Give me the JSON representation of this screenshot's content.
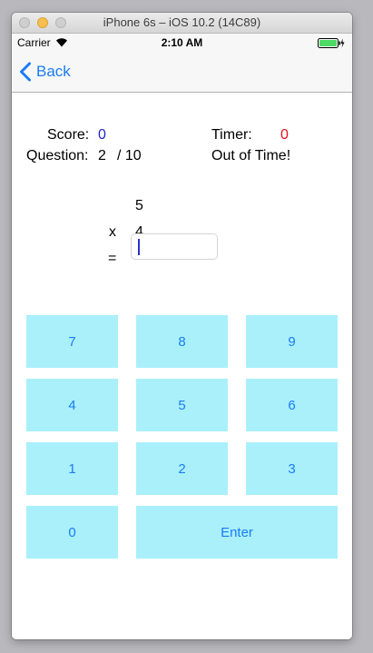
{
  "window": {
    "title": "iPhone 6s – iOS 10.2 (14C89)"
  },
  "status_bar": {
    "carrier": "Carrier",
    "time": "2:10 AM"
  },
  "nav": {
    "back_label": "Back"
  },
  "quiz": {
    "score_label": "Score:",
    "score_value": "0",
    "timer_label": "Timer:",
    "timer_value": "0",
    "question_label": "Question:",
    "question_current": "2",
    "question_total": "/ 10",
    "time_message": "Out of Time!",
    "operand_top": "5",
    "operator": "x",
    "operand_bottom": "4",
    "equals": "=",
    "answer_value": ""
  },
  "keypad": {
    "k7": "7",
    "k8": "8",
    "k9": "9",
    "k4": "4",
    "k5": "5",
    "k6": "6",
    "k1": "1",
    "k2": "2",
    "k3": "3",
    "k0": "0",
    "enter": "Enter"
  },
  "colors": {
    "key_background": "#aaf0fb",
    "key_text": "#1a7cf6",
    "score_value": "#2323c8",
    "timer_value": "#e8121a"
  }
}
